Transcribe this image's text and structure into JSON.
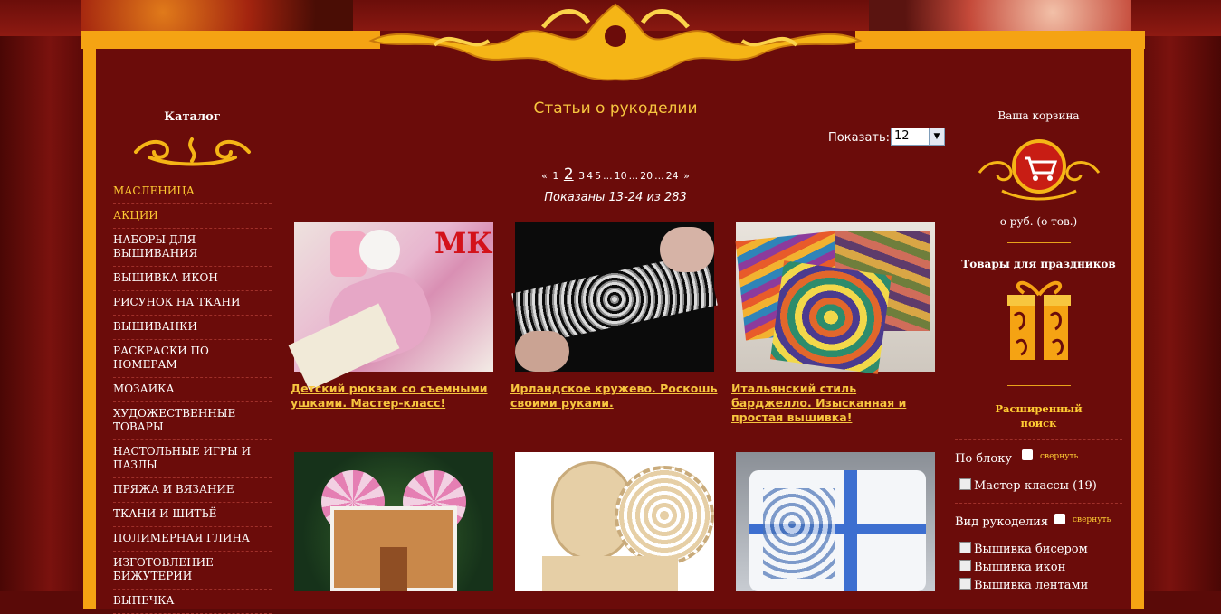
{
  "sidebar": {
    "title": "Каталог",
    "items": [
      {
        "label": "МАСЛЕНИЦА",
        "highlight": true
      },
      {
        "label": "АКЦИИ",
        "highlight": true
      },
      {
        "label": "НАБОРЫ ДЛЯ ВЫШИВАНИЯ"
      },
      {
        "label": "ВЫШИВКА ИКОН"
      },
      {
        "label": "РИСУНОК НА ТКАНИ"
      },
      {
        "label": "ВЫШИВАНКИ"
      },
      {
        "label": "РАСКРАСКИ ПО НОМЕРАМ"
      },
      {
        "label": "МОЗАИКА"
      },
      {
        "label": "ХУДОЖЕСТВЕННЫЕ ТОВАРЫ"
      },
      {
        "label": "НАСТОЛЬНЫЕ ИГРЫ И ПАЗЛЫ"
      },
      {
        "label": "ПРЯЖА И ВЯЗАНИЕ"
      },
      {
        "label": "ТКАНИ И ШИТЬЁ"
      },
      {
        "label": "ПОЛИМЕРНАЯ ГЛИНА"
      },
      {
        "label": "ИЗГОТОВЛЕНИЕ БИЖУТЕРИИ"
      },
      {
        "label": "ВЫПЕЧКА"
      }
    ]
  },
  "main": {
    "title": "Статьи о рукоделии",
    "show_label": "Показать:",
    "per_page": "12",
    "pager": {
      "prev": "«",
      "p1": "1",
      "current": "2",
      "p3": "3",
      "p4": "4",
      "p5": "5",
      "dots": "...",
      "p10": "10",
      "p20": "20",
      "p24": "24",
      "next": "»"
    },
    "shown_text": "Показаны 13-24 из 283",
    "articles": [
      {
        "title": "Детский рюкзак со съемными ушками. Мастер-класс!",
        "badge": "МК"
      },
      {
        "title": "Ирландское кружево. Роскошь своими руками."
      },
      {
        "title": "Итальянский стиль барджелло. Изысканная и простая вышивка!"
      },
      {
        "title": ""
      },
      {
        "title": ""
      },
      {
        "title": ""
      }
    ]
  },
  "right": {
    "cart_label": "Ваша корзина",
    "cart_sum": "о руб.   (о тов.)",
    "holiday_title": "Товары для праздников",
    "adv_search": "Расширенный поиск",
    "filter_block": {
      "title": "По блоку",
      "collapse": "свернуть",
      "options": [
        {
          "label": "Мастер-классы (19)"
        }
      ]
    },
    "filter_craft": {
      "title": "Вид рукоделия",
      "collapse": "свернуть",
      "options": [
        {
          "label": "Вышивка бисером"
        },
        {
          "label": "Вышивка икон"
        },
        {
          "label": "Вышивка лентами"
        }
      ]
    }
  },
  "colors": {
    "gold": "#f5a313",
    "maroon": "#6b0c0a",
    "link": "#f7c63f"
  }
}
